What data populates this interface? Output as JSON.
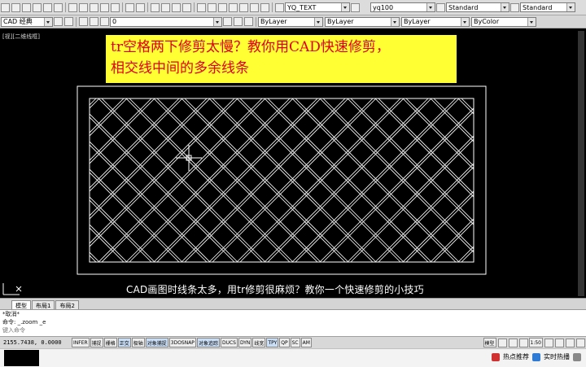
{
  "toolbar": {
    "style_combos": [
      "YQ_TEXT",
      "yq100",
      "Standard",
      "Standard"
    ]
  },
  "properties_bar": {
    "workspace": "CAD 经典",
    "layer_value": "0",
    "color": "ByLayer",
    "linetype": "ByLayer",
    "lineweight": "ByLayer",
    "plotstyle": "ByColor"
  },
  "viewport": {
    "label": "[视][二维线框]"
  },
  "banner": {
    "line1": "tr空格两下修剪太慢？教你用CAD快速修剪，",
    "line2": "相交线中间的多余线条"
  },
  "caption": "CAD画图时线条太多，用tr修剪很麻烦？教你一个快速修剪的小技巧",
  "tabs": [
    "模型",
    "布局1",
    "布局2"
  ],
  "command": {
    "line1": "*取消*",
    "line2": "命令: _.zoom _e",
    "prompt": "键入命令"
  },
  "status": {
    "coords": "2155.7438,  0.0000",
    "toggles": [
      "INFER",
      "捕捉",
      "栅格",
      "正交",
      "极轴",
      "对象捕捉",
      "3DOSNAP",
      "对象追踪",
      "DUCS",
      "DYN",
      "线宽",
      "TPY",
      "QP",
      "SC",
      "AM"
    ],
    "model": "模型",
    "scale": "1:50"
  },
  "taskbar": {
    "item1": "热点推荐",
    "item2": "实时热播"
  },
  "colors": {
    "banner_bg": "#ffff33",
    "banner_text": "#e0001a",
    "canvas": "#000000",
    "lines": "#ffffff"
  }
}
